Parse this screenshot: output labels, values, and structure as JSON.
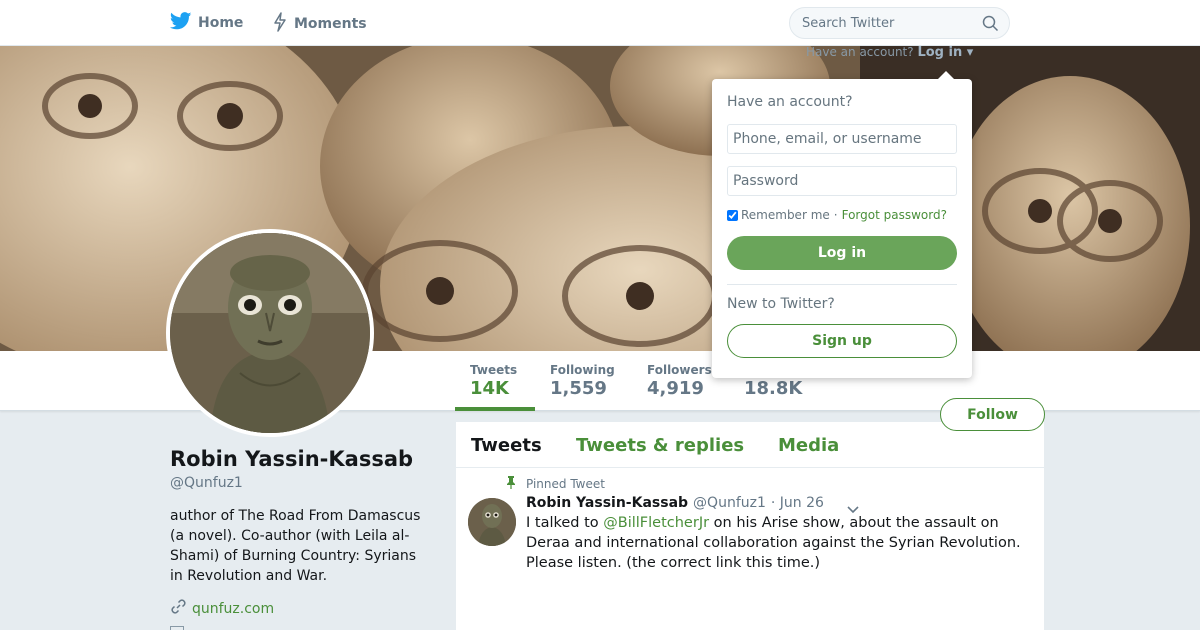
{
  "nav": {
    "home_label": "Home",
    "moments_label": "Moments",
    "search_placeholder": "Search Twitter"
  },
  "login_prompt": {
    "question": "Have an account?",
    "link": "Log in"
  },
  "login_dropdown": {
    "heading": "Have an account?",
    "username_placeholder": "Phone, email, or username",
    "password_placeholder": "Password",
    "remember_label": "Remember me",
    "separator": "·",
    "forgot_label": "Forgot password?",
    "login_button": "Log in",
    "new_heading": "New to Twitter?",
    "signup_button": "Sign up"
  },
  "stats": [
    {
      "label": "Tweets",
      "value": "14K"
    },
    {
      "label": "Following",
      "value": "1,559"
    },
    {
      "label": "Followers",
      "value": "4,919"
    },
    {
      "label": "",
      "value": "18.8K"
    }
  ],
  "follow_button": "Follow",
  "profile": {
    "name": "Robin Yassin-Kassab",
    "handle": "@Qunfuz1",
    "bio": "author of The Road From Damascus (a novel). Co-author (with Leila al-Shami) of Burning Country: Syrians in Revolution and War.",
    "website": "qunfuz.com"
  },
  "timeline": {
    "tabs": [
      "Tweets",
      "Tweets & replies",
      "Media"
    ],
    "pinned_label": "Pinned Tweet",
    "tweet": {
      "author": "Robin Yassin-Kassab",
      "handle": "@Qunfuz1",
      "date": "· Jun 26",
      "text_before": "I talked to ",
      "mention": "@BillFletcherJr",
      "text_after": " on his Arise show, about the assault on Deraa and international collaboration against the Syrian Revolution. Please listen. (the correct link this time.)"
    }
  },
  "colors": {
    "accent": "#4a8f3a",
    "login_button": "#6aa55a",
    "twitter_blue": "#1da1f2"
  },
  "icons": {
    "home": "twitter-bird-icon",
    "moments": "lightning-icon",
    "search": "search-icon",
    "pinned": "pin-icon",
    "link": "link-icon",
    "caret": "chevron-down-icon"
  }
}
